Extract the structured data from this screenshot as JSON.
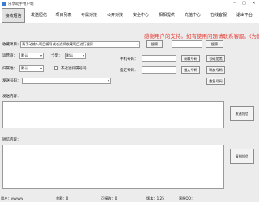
{
  "window": {
    "title": "乐享助手用户端"
  },
  "tabs": [
    {
      "label": "接收短信"
    },
    {
      "label": "发送短信"
    },
    {
      "label": "项目列表"
    },
    {
      "label": "专属对接"
    },
    {
      "label": "公开对接"
    },
    {
      "label": "安全中心"
    },
    {
      "label": "相相提供"
    },
    {
      "label": "充值中心"
    },
    {
      "label": "在线客服"
    },
    {
      "label": "退出平台"
    }
  ],
  "form": {
    "project_label": "收藏项目：",
    "project_value": "请手动输入项目编号或者选择收藏项目进行搜索",
    "search_button": "搜索",
    "search_button_2": "搜索",
    "notice": "感谢用户的支持。如有使用问题请联系客服。(为便于",
    "operator_label": "运营商：",
    "operator_value": "默认",
    "card_type_label": "卡型：",
    "card_type_value": "默认",
    "phone_label": "手机号码：",
    "get_number_button": "获取号码",
    "release_number_button": "号码加黑",
    "region_label": "归属地：",
    "region_value": "默认",
    "exclude_checkbox_label": "不过滤归属号码",
    "specified_number_label": "指定号码：",
    "specified_number_button": "指定号码",
    "release_button": "释放号码",
    "repeat_button": "重复号码",
    "send_number_label": "发送号码：",
    "send_content_label": "发送内容：",
    "send_sms_button": "发送短信",
    "receive_content_label": "短信内容：",
    "copy_sms_button": "复制短信"
  },
  "status": {
    "user": "用户：yyyyyy",
    "balance": "余额：0",
    "quota": "可接收：0",
    "version": "版本：1.25",
    "contact": "客服QQ："
  }
}
